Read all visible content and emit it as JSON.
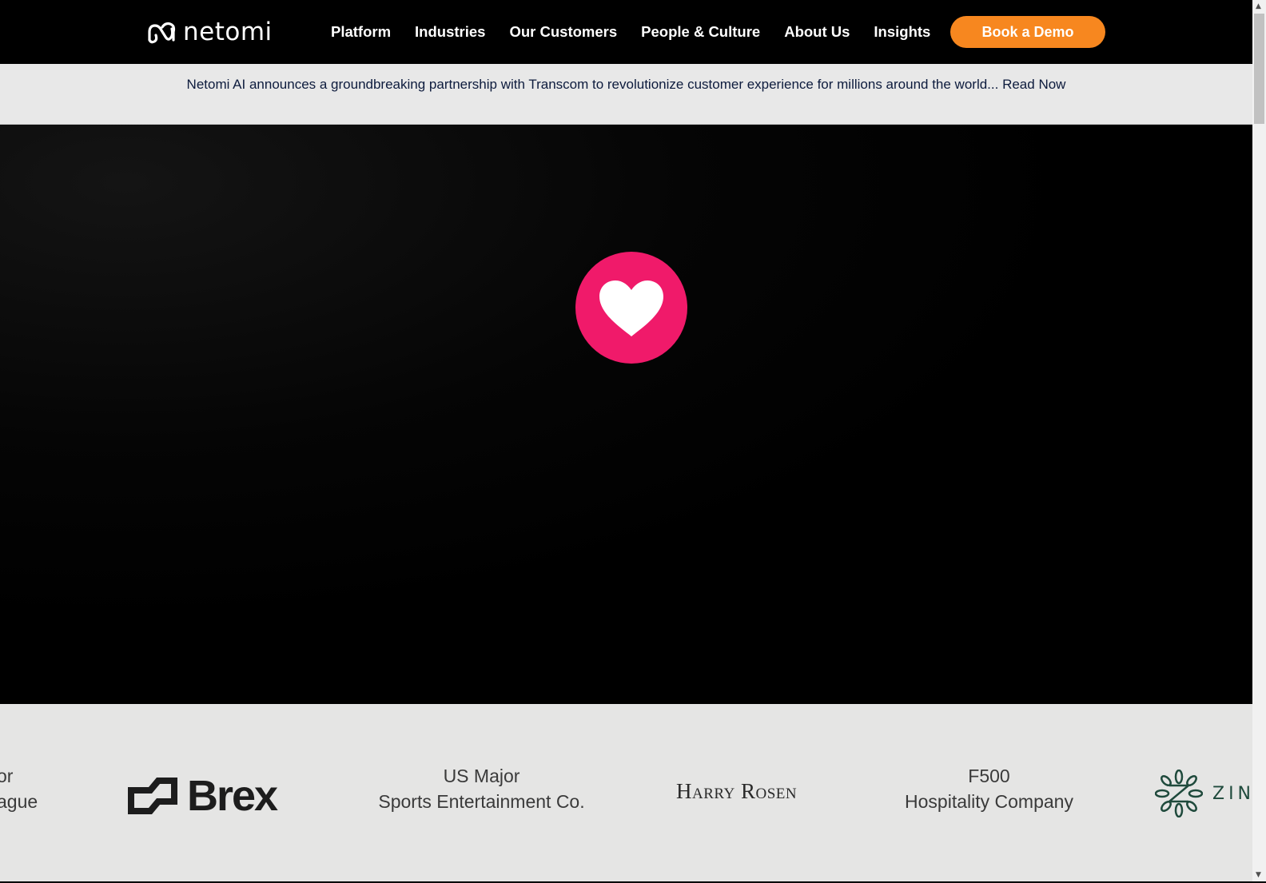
{
  "nav": {
    "logo": "netomi",
    "items": [
      "Platform",
      "Industries",
      "Our Customers",
      "People & Culture",
      "About Us",
      "Insights"
    ],
    "cta": "Book a Demo",
    "cta_color": "#f7871f"
  },
  "banner": {
    "text": "Netomi AI announces a groundbreaking partnership with Transcom to revolutionize customer experience for millions around the world... Read Now"
  },
  "hero": {
    "icon": "heart-icon",
    "icon_bg": "#f01a6a"
  },
  "logos": {
    "partial_left": [
      "or",
      "ague"
    ],
    "brex": "Brex",
    "us_major": [
      "US Major",
      "Sports Entertainment Co."
    ],
    "harry_rosen": "Harry Rosen",
    "f500": [
      "F500",
      "Hospitality Company"
    ],
    "zin": "ZIN"
  }
}
